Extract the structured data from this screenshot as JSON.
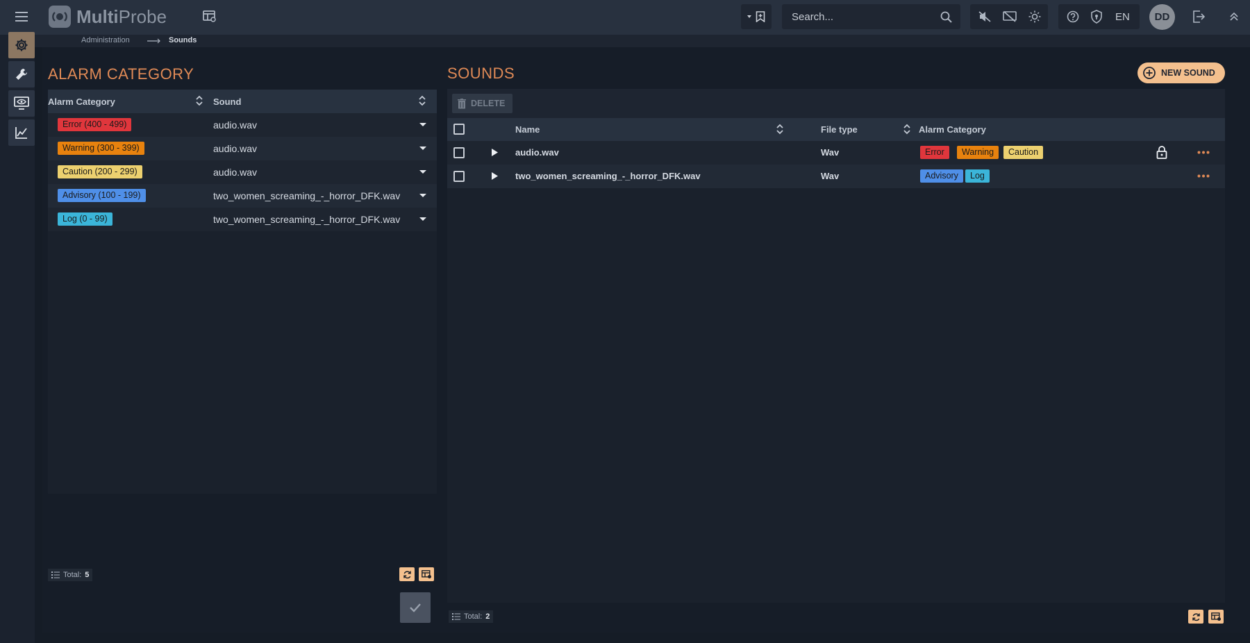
{
  "app": {
    "name_bold": "Multi",
    "name_light": "Probe"
  },
  "header": {
    "search_placeholder": "Search...",
    "language": "EN",
    "user_initials": "DD"
  },
  "breadcrumb": {
    "parent": "Administration",
    "current": "Sounds"
  },
  "left": {
    "title": "ALARM CATEGORY",
    "columns": {
      "category": "Alarm Category",
      "sound": "Sound"
    },
    "rows": [
      {
        "category": "Error (400 - 499)",
        "sound": "audio.wav",
        "color": "#e0363c"
      },
      {
        "category": "Warning (300 - 399)",
        "sound": "audio.wav",
        "color": "#e8820e"
      },
      {
        "category": "Caution (200 - 299)",
        "sound": "audio.wav",
        "color": "#ecd06f"
      },
      {
        "category": "Advisory (100 - 199)",
        "sound": "two_women_screaming_-_horror_DFK.wav",
        "color": "#4f8fe8"
      },
      {
        "category": "Log (0 - 99)",
        "sound": "two_women_screaming_-_horror_DFK.wav",
        "color": "#3bb5d9"
      }
    ],
    "footer": {
      "total_label": "Total:",
      "total_value": "5"
    }
  },
  "right": {
    "title": "SOUNDS",
    "new_button": "NEW SOUND",
    "delete_button": "DELETE",
    "columns": {
      "name": "Name",
      "file_type": "File type",
      "alarm_category": "Alarm Category"
    },
    "rows": [
      {
        "name": "audio.wav",
        "file_type": "Wav",
        "tags": [
          "Error",
          "Warning",
          "Caution"
        ],
        "locked": true
      },
      {
        "name": "two_women_screaming_-_horror_DFK.wav",
        "file_type": "Wav",
        "tags": [
          "Advisory",
          "Log"
        ],
        "locked": false
      }
    ],
    "footer": {
      "total_label": "Total:",
      "total_value": "2"
    }
  },
  "colors": {
    "accent": "#e08a56",
    "orange_button": "#f4c08e",
    "tag_error": "#e0363c",
    "tag_warning": "#e8820e",
    "tag_caution": "#ecd06f",
    "tag_advisory": "#4f8fe8",
    "tag_log": "#3bb5d9"
  }
}
